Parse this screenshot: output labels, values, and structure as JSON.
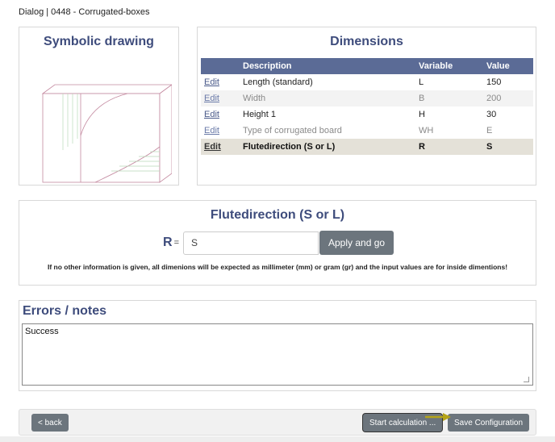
{
  "page": {
    "title": "Dialog | 0448 - Corrugated-boxes"
  },
  "drawing": {
    "title": "Symbolic drawing"
  },
  "dimensions": {
    "title": "Dimensions",
    "columns": [
      "",
      "Description",
      "Variable",
      "Value"
    ],
    "rows": [
      {
        "edit": "Edit",
        "description": "Length (standard)",
        "variable": "L",
        "value": "150"
      },
      {
        "edit": "Edit",
        "description": "Width",
        "variable": "B",
        "value": "200"
      },
      {
        "edit": "Edit",
        "description": "Height 1",
        "variable": "H",
        "value": "30"
      },
      {
        "edit": "Edit",
        "description": "Type of corrugated board",
        "variable": "WH",
        "value": "E"
      },
      {
        "edit": "Edit",
        "description": "Flutedirection (S or L)",
        "variable": "R",
        "value": "S"
      }
    ]
  },
  "flute": {
    "title": "Flutedirection (S or L)",
    "variable": "R",
    "equals": "=",
    "input_value": "S",
    "apply_label": "Apply and go",
    "note": "If no other information is given, all dimenions will be expected as millimeter (mm) or gram (gr) and the input values are for inside dimentions!"
  },
  "errors": {
    "title": "Errors / notes",
    "text": "Success"
  },
  "footer": {
    "back_label": "< back",
    "calc_label": "Start calculation ...",
    "save_label": "Save Configuration"
  },
  "colors": {
    "accent": "#3e4c7c",
    "table_header": "#5b6b96",
    "button": "#6c757d",
    "arrow": "#b5a419"
  }
}
